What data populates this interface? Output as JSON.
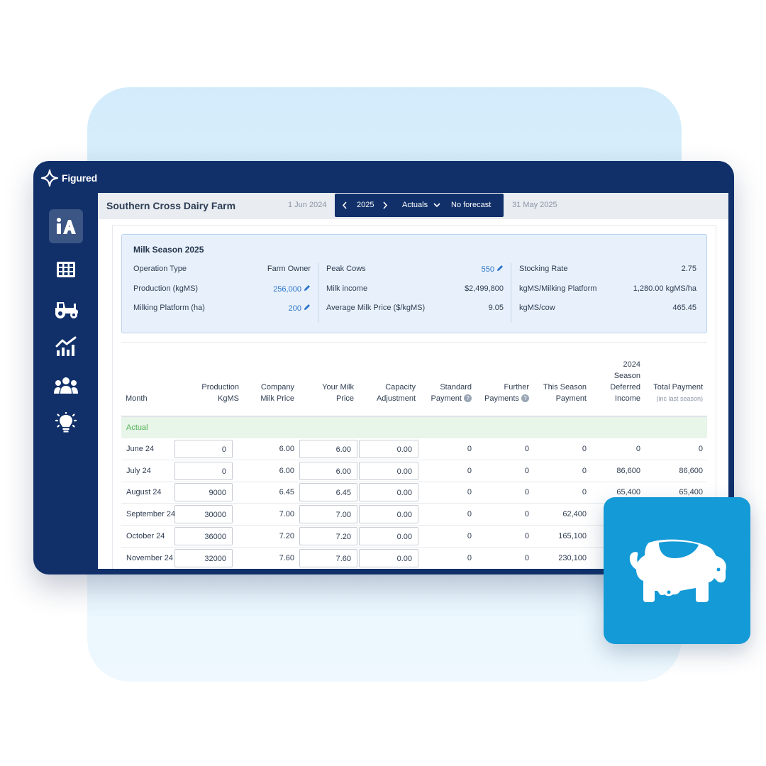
{
  "brand": {
    "name": "Figured"
  },
  "sidebar": {
    "items": [
      {
        "icon": "ia-logo-icon",
        "active": true
      },
      {
        "icon": "grid-table-icon",
        "active": false
      },
      {
        "icon": "tractor-icon",
        "active": false
      },
      {
        "icon": "chart-trend-icon",
        "active": false
      },
      {
        "icon": "people-group-icon",
        "active": false
      },
      {
        "icon": "lightbulb-icon",
        "active": false
      }
    ]
  },
  "header": {
    "farm_name": "Southern Cross Dairy Farm",
    "start_date": "1 Jun 2024",
    "end_date": "31 May 2025",
    "year": "2025",
    "mode": "Actuals",
    "forecast": "No forecast"
  },
  "summary": {
    "title": "Milk Season 2025",
    "col1": [
      {
        "label": "Operation Type",
        "value": "Farm Owner",
        "editable": false
      },
      {
        "label": "Production (kgMS)",
        "value": "256,000",
        "editable": true
      },
      {
        "label": "Milking Platform (ha)",
        "value": "200",
        "editable": true
      }
    ],
    "col2": [
      {
        "label": "Peak Cows",
        "value": "550",
        "editable": true
      },
      {
        "label": "Milk income",
        "value": "$2,499,800",
        "editable": false
      },
      {
        "label": "Average Milk Price ($/kgMS)",
        "value": "9.05",
        "editable": false
      }
    ],
    "col3": [
      {
        "label": "Stocking Rate",
        "value": "2.75"
      },
      {
        "label": "kgMS/Milking Platform",
        "value": "1,280.00 kgMS/ha"
      },
      {
        "label": "kgMS/cow",
        "value": "465.45"
      }
    ]
  },
  "table": {
    "headers": {
      "month": "Month",
      "production_1": "Production",
      "production_2": "KgMS",
      "company_1": "Company",
      "company_2": "Milk Price",
      "your_1": "Your Milk",
      "your_2": "Price",
      "capacity_1": "Capacity",
      "capacity_2": "Adjustment",
      "standard_1": "Standard",
      "standard_2": "Payment",
      "further_1": "Further",
      "further_2": "Payments",
      "this_1": "This Season",
      "this_2": "Payment",
      "deferred_1": "2024",
      "deferred_2": "Season",
      "deferred_3": "Deferred",
      "deferred_4": "Income",
      "total_1": "Total Payment",
      "total_2": "(inc last season)"
    },
    "section_label": "Actual",
    "rows": [
      {
        "month": "June 24",
        "production": "0",
        "company_price": "6.00",
        "your_price": "6.00",
        "capacity": "0.00",
        "standard": "0",
        "further": "0",
        "this_season": "0",
        "deferred": "0",
        "total": "0"
      },
      {
        "month": "July 24",
        "production": "0",
        "company_price": "6.00",
        "your_price": "6.00",
        "capacity": "0.00",
        "standard": "0",
        "further": "0",
        "this_season": "0",
        "deferred": "86,600",
        "total": "86,600"
      },
      {
        "month": "August 24",
        "production": "9000",
        "company_price": "6.45",
        "your_price": "6.45",
        "capacity": "0.00",
        "standard": "0",
        "further": "0",
        "this_season": "0",
        "deferred": "65,400",
        "total": "65,400"
      },
      {
        "month": "September 24",
        "production": "30000",
        "company_price": "7.00",
        "your_price": "7.00",
        "capacity": "0.00",
        "standard": "0",
        "further": "0",
        "this_season": "62,400",
        "deferred": "",
        "total": ""
      },
      {
        "month": "October 24",
        "production": "36000",
        "company_price": "7.20",
        "your_price": "7.20",
        "capacity": "0.00",
        "standard": "0",
        "further": "0",
        "this_season": "165,100",
        "deferred": "",
        "total": ""
      },
      {
        "month": "November 24",
        "production": "32000",
        "company_price": "7.60",
        "your_price": "7.60",
        "capacity": "0.00",
        "standard": "0",
        "further": "0",
        "this_season": "230,100",
        "deferred": "",
        "total": ""
      }
    ]
  },
  "badge": {
    "icon": "cow-icon",
    "color": "#149ad6"
  },
  "colors": {
    "navy": "#11306a",
    "link": "#2a73c9",
    "actual_green": "#4caf50"
  }
}
